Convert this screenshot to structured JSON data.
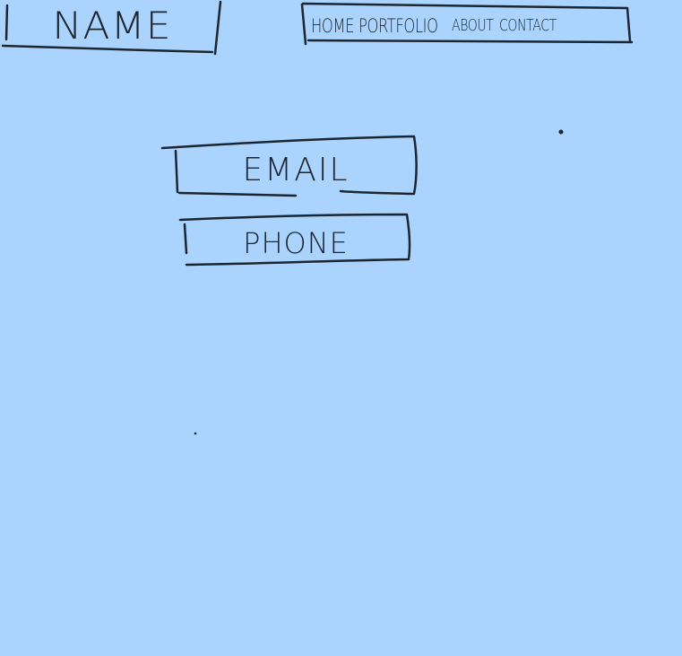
{
  "header": {
    "name": "NAME",
    "nav": [
      {
        "label": "HOME"
      },
      {
        "label": "PORTFOLIO"
      },
      {
        "label": "ABOUT"
      },
      {
        "label": "CONTACT"
      }
    ]
  },
  "contact": {
    "email_label": "EMAIL",
    "phone_label": "PHONE"
  },
  "colors": {
    "paper": "#aad4fd",
    "ink": "#1c2530"
  }
}
